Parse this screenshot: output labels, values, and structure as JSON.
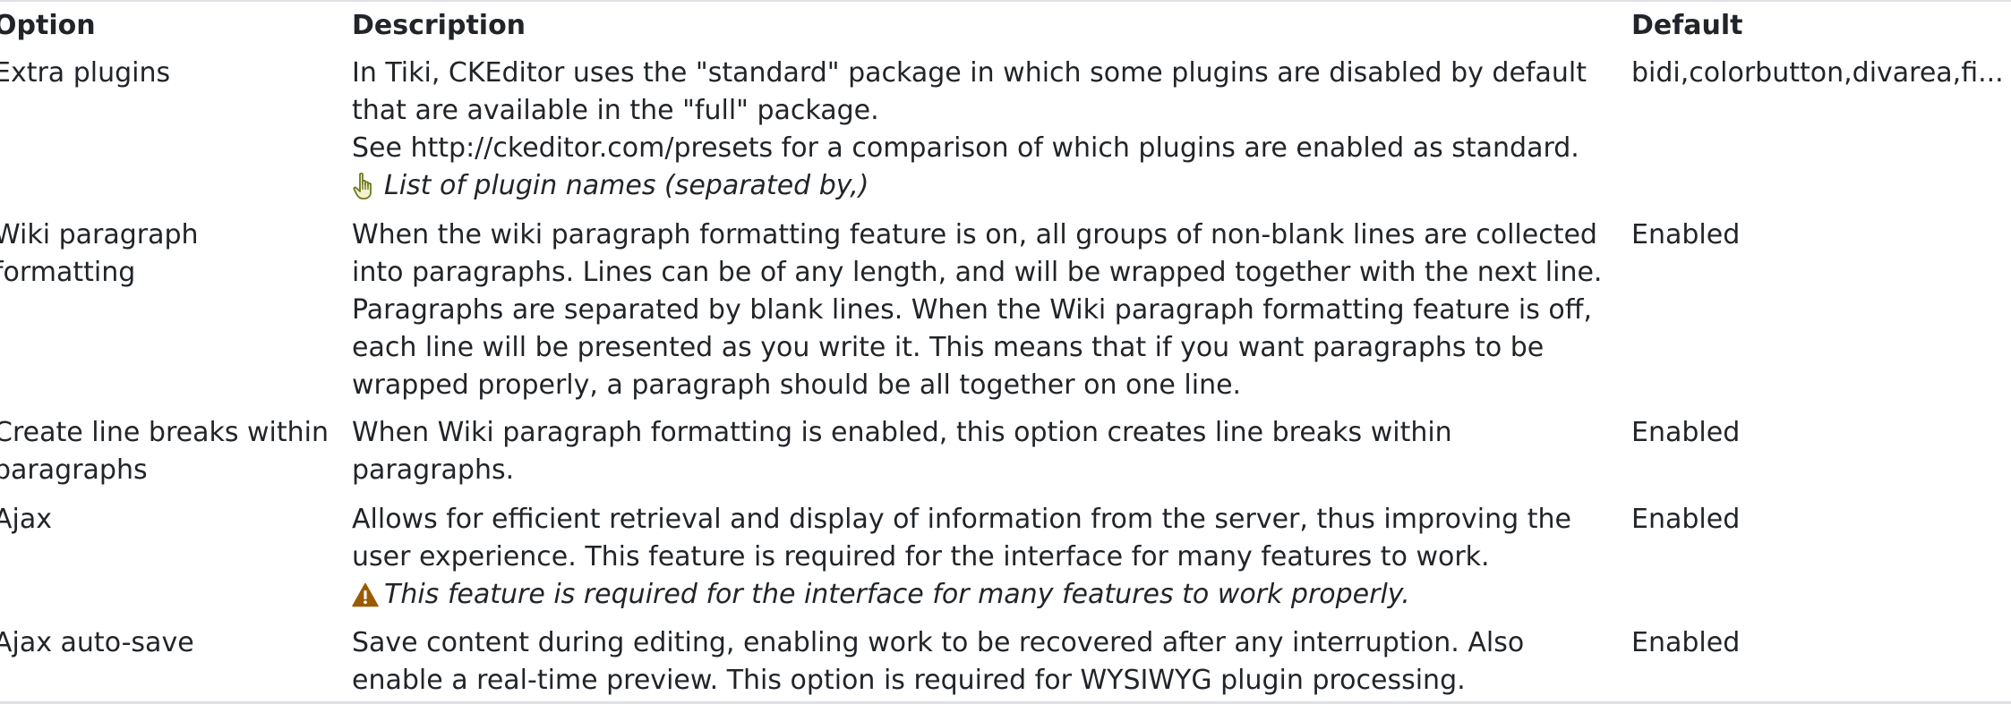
{
  "table": {
    "headers": {
      "option": "Option",
      "description": "Description",
      "default": "Default"
    },
    "rows": [
      {
        "option": "Extra plugins",
        "description_lines": [
          "In Tiki, CKEditor uses the \"standard\" package in which some plugins are disabled by default",
          "that are available in the \"full\" package.",
          "See http://ckeditor.com/presets for a comparison of which plugins are enabled as standard."
        ],
        "hint": "List of plugin names (separated by,)",
        "hint_icon": "pointing-hand-icon",
        "default": "bidi,colorbutton,divarea,fi..."
      },
      {
        "option": "Wiki paragraph formatting",
        "description": "When the wiki paragraph formatting feature is on, all groups of non-blank lines are collected into paragraphs. Lines can be of any length, and will be wrapped together with the next line. Paragraphs are separated by blank lines. When the Wiki paragraph formatting feature is off, each line will be presented as you write it. This means that if you want paragraphs to be wrapped properly, a paragraph should be all together on one line.",
        "default": "Enabled"
      },
      {
        "option": "Create line breaks within paragraphs",
        "description": "When Wiki paragraph formatting is enabled, this option creates line breaks within paragraphs.",
        "default": "Enabled"
      },
      {
        "option": "Ajax",
        "description": "Allows for efficient retrieval and display of information from the server, thus improving the user experience. This feature is required for the interface for many features to work.",
        "warning": "This feature is required for the interface for many features to work properly.",
        "warning_icon": "warning-icon",
        "default": "Enabled"
      },
      {
        "option": "Ajax auto-save",
        "description": "Save content during editing, enabling work to be recovered after any interruption. Also enable a real-time preview. This option is required for WYSIWYG plugin processing.",
        "default": "Enabled"
      }
    ]
  },
  "colors": {
    "text": "#212529",
    "border": "#dee2e6",
    "hint_icon": "#6b7a1f",
    "warning_icon": "#9c5a00"
  }
}
